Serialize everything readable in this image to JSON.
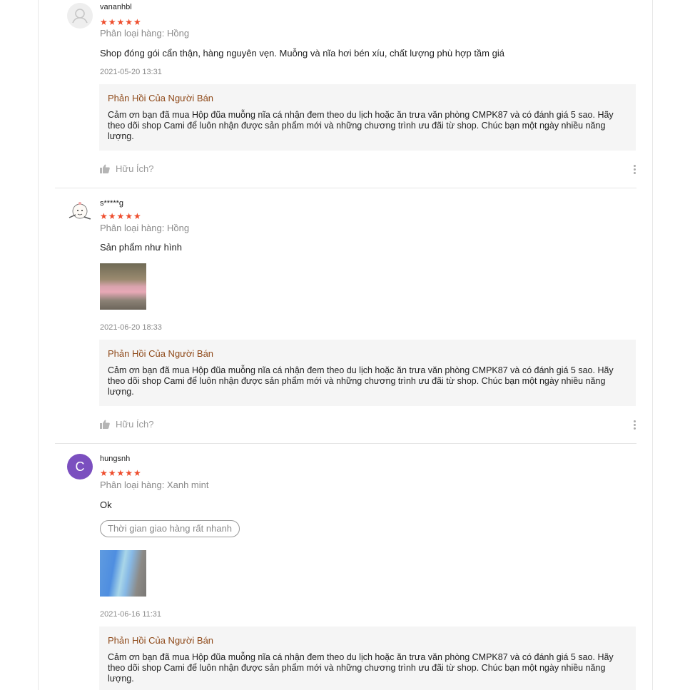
{
  "reviews": [
    {
      "username": "vananhbl",
      "stars": "★★★★★",
      "variation": "Phân loại hàng: Hồng",
      "content": "Shop đóng gói cẩn thận, hàng nguyên vẹn. Muỗng và nĩa hơi bén xíu, chất lượng phù hợp tầm giá",
      "time": "2021-05-20 13:31",
      "reply_title": "Phản Hồi Của Người Bán",
      "reply_text": "Cảm ơn bạn đã mua Hộp đũa muỗng nĩa cá nhận đem theo du lịch hoặc ăn trưa văn phòng CMPK87 và có đánh giá 5 sao. Hãy theo dõi shop Cami để luôn nhận được sản phẩm mới và những chương trình ưu đãi từ shop. Chúc bạn một ngày nhiều năng lượng.",
      "helpful": "Hữu Ích?"
    },
    {
      "username": "s*****g",
      "stars": "★★★★★",
      "variation": "Phân loại hàng: Hồng",
      "content": "Sản phẩm như hình",
      "time": "2021-06-20 18:33",
      "reply_title": "Phản Hồi Của Người Bán",
      "reply_text": "Cảm ơn bạn đã mua Hộp đũa muỗng nĩa cá nhận đem theo du lịch hoặc ăn trưa văn phòng CMPK87 và có đánh giá 5 sao. Hãy theo dõi shop Cami để luôn nhận được sản phẩm mới và những chương trình ưu đãi từ shop. Chúc bạn một ngày nhiều năng lượng.",
      "helpful": "Hữu Ích?"
    },
    {
      "username": "hungsnh",
      "avatar_letter": "C",
      "stars": "★★★★★",
      "variation": "Phân loại hàng: Xanh mint",
      "content": "Ok",
      "tag": "Thời gian giao hàng rất nhanh",
      "time": "2021-06-16 11:31",
      "reply_title": "Phản Hồi Của Người Bán",
      "reply_text": "Cảm ơn bạn đã mua Hộp đũa muỗng nĩa cá nhận đem theo du lịch hoặc ăn trưa văn phòng CMPK87 và có đánh giá 5 sao. Hãy theo dõi shop Cami để luôn nhận được sản phẩm mới và những chương trình ưu đãi từ shop. Chúc bạn một ngày nhiều năng lượng."
    }
  ],
  "colors": {
    "star": "#ee4d2d",
    "reply_title": "#8f4a1a",
    "reply_bg": "#f5f5f5",
    "avatar_c": "#7b4fbf"
  },
  "icons": {
    "helpful": "thumbs-up-icon",
    "more": "more-vertical-icon",
    "default_avatar": "user-icon"
  }
}
